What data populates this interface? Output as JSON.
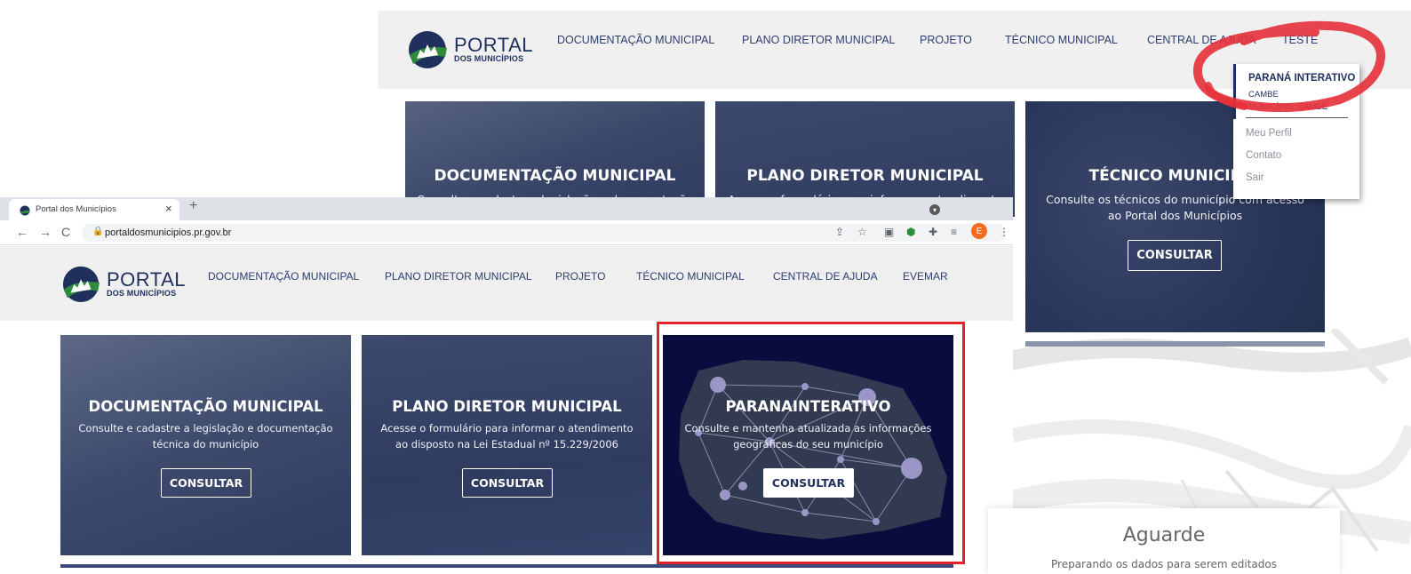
{
  "back": {
    "logo": {
      "portal": "PORTAL",
      "dos": "DOS MUNICÍPIOS"
    },
    "nav": [
      "DOCUMENTAÇÃO MUNICIPAL",
      "PLANO DIRETOR MUNICIPAL",
      "PROJETO",
      "TÉCNICO MUNICIPAL",
      "CENTRAL DE AJUDA",
      "TESTE"
    ],
    "cards": [
      {
        "title": "DOCUMENTAÇÃO MUNICIPAL",
        "desc": "Consulte e cadastre a legislação e documentação"
      },
      {
        "title": "PLANO DIRETOR MUNICIPAL",
        "desc": "Acesse o formulário para informar o atendimento"
      },
      {
        "title": "TÉCNICO MUNICIPAL",
        "desc": "Consulte os técnicos do município com acesso ao Portal dos Municípios",
        "button": "CONSULTAR"
      }
    ],
    "dropdown": {
      "title": "PARANÁ INTERATIVO",
      "sub1": "CAMBE",
      "sub2": "MUNICÍPIO: CAMBÉ",
      "links": [
        "Meu Perfil",
        "Contato",
        "Sair"
      ]
    }
  },
  "front": {
    "tab": {
      "title": "Portal dos Municípios"
    },
    "url": "portaldosmunicipios.pr.gov.br",
    "profile_initial": "E",
    "logo": {
      "portal": "PORTAL",
      "dos": "DOS MUNICÍPIOS"
    },
    "nav": [
      "DOCUMENTAÇÃO MUNICIPAL",
      "PLANO DIRETOR MUNICIPAL",
      "PROJETO",
      "TÉCNICO MUNICIPAL",
      "CENTRAL DE AJUDA",
      "EVEMAR"
    ],
    "cards": [
      {
        "title": "DOCUMENTAÇÃO MUNICIPAL",
        "desc1": "Consulte e cadastre a legislação e documentação",
        "desc2": "técnica do município",
        "button": "CONSULTAR"
      },
      {
        "title": "PLANO DIRETOR MUNICIPAL",
        "desc1": "Acesse o formulário para informar o atendimento",
        "desc2": "ao disposto na Lei Estadual nº 15.229/2006",
        "button": "CONSULTAR"
      },
      {
        "title": "PARANAINTERATIVO",
        "desc1": "Consulte e mantenha atualizada as informações",
        "desc2": "geográficas do seu município",
        "button": "CONSULTAR"
      }
    ]
  },
  "loading": {
    "title": "Aguarde",
    "subtitle": "Preparando os dados para serem editados"
  },
  "colors": {
    "navy": "#1f2f5e",
    "card_bg": "#2f3f66",
    "parana_bg": "#0b0c3e",
    "highlight": "#e0242a",
    "accent_green": "#2e8b3a"
  }
}
